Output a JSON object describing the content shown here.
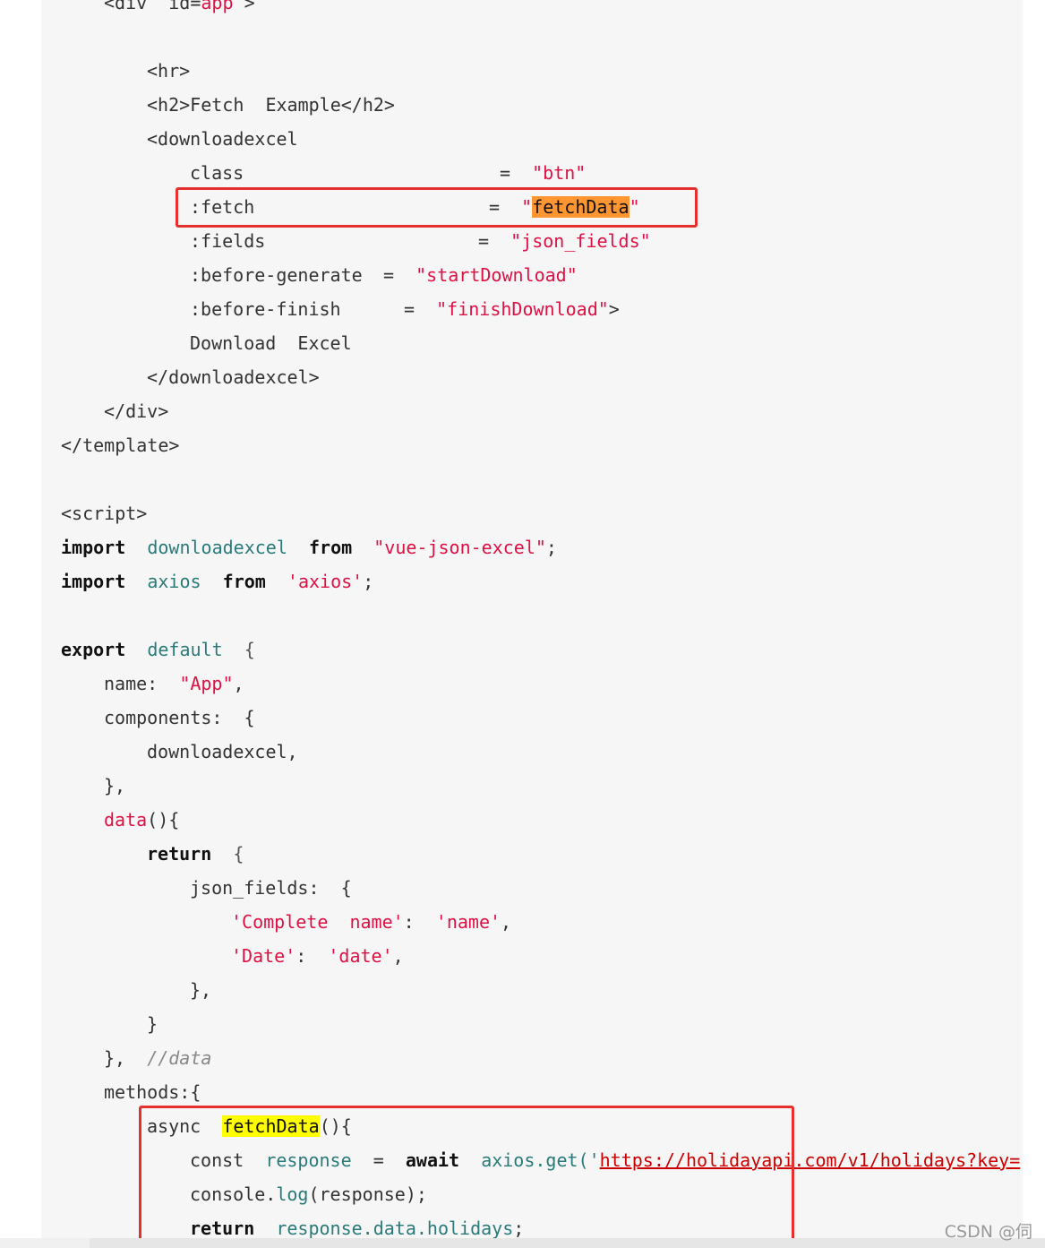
{
  "code": {
    "l0_tag": "<div",
    "l0_attr": "id=",
    "l0_val": "app",
    "l0_end": ">",
    "l1": "<hr>",
    "l2": "<h2>Fetch  Example</h2>",
    "l3": "<downloadexcel",
    "l4_attr": "class",
    "l4_eq": "=",
    "l4_val": "\"btn\"",
    "l5_attr": ":fetch",
    "l5_eq": "=",
    "l5_q1": "\"",
    "l5_val": "fetchData",
    "l5_q2": "\"",
    "l6_attr": ":fields",
    "l6_eq": "=",
    "l6_val": "\"json_fields\"",
    "l7_attr": ":before-generate",
    "l7_eq": "=",
    "l7_val": "\"startDownload\"",
    "l8_attr": ":before-finish",
    "l8_eq": "=",
    "l8_val": "\"finishDownload\"",
    "l8_end": ">",
    "l9": "Download  Excel",
    "l10": "</downloadexcel>",
    "l11": "</div>",
    "l12": "</template>",
    "l14": "<script>",
    "l15_kw": "import",
    "l15_id": "downloadexcel",
    "l15_from": "from",
    "l15_str": "\"vue-json-excel\"",
    "l15_end": ";",
    "l16_kw": "import",
    "l16_id": "axios",
    "l16_from": "from",
    "l16_str": "'axios'",
    "l16_end": ";",
    "l18_kw": "export",
    "l18_id": "default",
    "l18_end": "{",
    "l19_key": "name:",
    "l19_str": "\"App\"",
    "l19_end": ",",
    "l20": "components:  {",
    "l21": "downloadexcel,",
    "l22": "},",
    "l23_fn": "data",
    "l23_end": "(){",
    "l24_kw": "return",
    "l24_end": "{",
    "l25": "json_fields:  {",
    "l26_key": "'Complete  name'",
    "l26_colon": ":",
    "l26_val": "'name'",
    "l26_end": ",",
    "l27_key": "'Date'",
    "l27_colon": ":",
    "l27_val": "'date'",
    "l27_end": ",",
    "l28": "},",
    "l29": "}",
    "l30_code": "},",
    "l30_cmt": "//data",
    "l31": "methods:{",
    "l32_kw": "async",
    "l32_fn": "fetchData",
    "l32_end": "(){",
    "l33_kw": "const",
    "l33_id": "response",
    "l33_eq": "=",
    "l33_await": "await",
    "l33_obj": "axios.get('",
    "l33_url": "https://holidayapi.com/v1/holidays?key=",
    "l34_pre": "console.",
    "l34_fn": "log",
    "l34_end": "(response);",
    "l35_kw": "return",
    "l35_id": "response.data.holidays",
    "l35_end": ";"
  },
  "watermark": "CSDN @伺"
}
